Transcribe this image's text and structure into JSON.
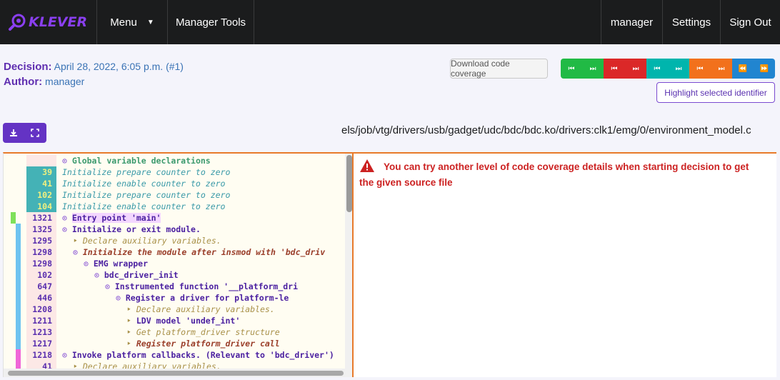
{
  "navbar": {
    "logo_text": "KLEVER",
    "menu_label": "Menu",
    "manager_tools_label": "Manager Tools",
    "user_label": "manager",
    "settings_label": "Settings",
    "signout_label": "Sign Out"
  },
  "decision": {
    "decision_label": "Decision:",
    "decision_value": "April 28, 2022, 6:05 p.m. (#1)",
    "author_label": "Author:",
    "author_value": "manager"
  },
  "toolbar": {
    "download_coverage_label": "Download code coverage",
    "highlight_label": "Highlight selected identifier",
    "nav_groups": [
      {
        "color": "#21ba45",
        "icons": [
          "skip-back-icon",
          "skip-forward-icon"
        ]
      },
      {
        "color": "#db2828",
        "icons": [
          "skip-back-icon",
          "skip-forward-icon"
        ]
      },
      {
        "color": "#00b5ad",
        "icons": [
          "skip-back-icon",
          "skip-forward-icon"
        ]
      },
      {
        "color": "#f2711c",
        "icons": [
          "skip-back-icon",
          "skip-forward-icon"
        ]
      },
      {
        "color": "#2185d0",
        "icons": [
          "rewind-icon",
          "fast-forward-icon"
        ]
      }
    ],
    "file_buttons": [
      "download-icon",
      "expand-icon"
    ]
  },
  "file_path": "els/job/vtg/drivers/usb/gadget/udc/bdc/bdc.ko/drivers:clk1/emg/0/environment_model.c",
  "code_lines": [
    {
      "num": "",
      "indent": 0,
      "icon": "⊙",
      "text": "Global variable declarations",
      "style": "green-bold",
      "num_bg": "#fce8e6",
      "bar": ""
    },
    {
      "num": "39",
      "indent": 0,
      "icon": "",
      "text": "Initialize prepare counter to zero",
      "style": "teal-italic",
      "num_bg": "#44b2b6",
      "bar": ""
    },
    {
      "num": "41",
      "indent": 0,
      "icon": "",
      "text": "Initialize enable counter to zero",
      "style": "teal-italic",
      "num_bg": "#44b2b6",
      "bar": ""
    },
    {
      "num": "102",
      "indent": 0,
      "icon": "",
      "text": "Initialize prepare counter to zero",
      "style": "teal-italic",
      "num_bg": "#44b2b6",
      "bar": ""
    },
    {
      "num": "104",
      "indent": 0,
      "icon": "",
      "text": "Initialize enable counter to zero",
      "style": "teal-italic",
      "num_bg": "#44b2b6",
      "bar": ""
    },
    {
      "num": "1321",
      "indent": 0,
      "icon": "⊙",
      "text": "Entry point 'main'",
      "style": "purple-bold-hl",
      "num_bg": "#fce8e6",
      "bar": "#7ee05a"
    },
    {
      "num": "1325",
      "indent": 0,
      "icon": "⊙",
      "text": "Initialize or exit module.",
      "style": "purple-bold",
      "num_bg": "#fce8e6",
      "bar": "#6ec3f0"
    },
    {
      "num": "1295",
      "indent": 1,
      "icon": "‣",
      "text": "Declare auxiliary variables.",
      "style": "olive-italic",
      "num_bg": "#fce8e6",
      "bar": "#6ec3f0"
    },
    {
      "num": "1298",
      "indent": 1,
      "icon": "⊙",
      "text": "Initialize the module after insmod with 'bdc_driv",
      "style": "brown-bold-italic",
      "num_bg": "#fce8e6",
      "bar": "#6ec3f0"
    },
    {
      "num": "1298",
      "indent": 2,
      "icon": "⊙",
      "text": "EMG wrapper",
      "style": "purple-bold",
      "num_bg": "#fce8e6",
      "bar": "#6ec3f0"
    },
    {
      "num": "102",
      "indent": 3,
      "icon": "⊙",
      "text": "bdc_driver_init",
      "style": "purple-bold",
      "num_bg": "#fce8e6",
      "bar": "#6ec3f0"
    },
    {
      "num": "647",
      "indent": 4,
      "icon": "⊙",
      "text": "Instrumented function '__platform_dri",
      "style": "purple-bold",
      "num_bg": "#fce8e6",
      "bar": "#6ec3f0"
    },
    {
      "num": "446",
      "indent": 5,
      "icon": "⊙",
      "text": "Register a driver for platform-le",
      "style": "purple-bold",
      "num_bg": "#fce8e6",
      "bar": "#6ec3f0"
    },
    {
      "num": "1208",
      "indent": 6,
      "icon": "‣",
      "text": "Declare auxiliary variables.",
      "style": "olive-italic",
      "num_bg": "#fce8e6",
      "bar": "#6ec3f0"
    },
    {
      "num": "1211",
      "indent": 6,
      "icon": "‣",
      "text": "LDV model 'undef_int'",
      "style": "purple-bold",
      "num_bg": "#fce8e6",
      "bar": "#6ec3f0"
    },
    {
      "num": "1213",
      "indent": 6,
      "icon": "‣",
      "text": "Get platform_driver structure",
      "style": "olive-italic",
      "num_bg": "#fce8e6",
      "bar": "#6ec3f0"
    },
    {
      "num": "1217",
      "indent": 6,
      "icon": "‣",
      "text": "Register platform_driver call",
      "style": "brown-bold-italic",
      "num_bg": "#fce8e6",
      "bar": "#6ec3f0"
    },
    {
      "num": "1218",
      "indent": 0,
      "icon": "⊙",
      "text": "Invoke platform callbacks. (Relevant to 'bdc_driver')",
      "style": "purple-bold",
      "num_bg": "#fce8e6",
      "bar": "#f066d8"
    },
    {
      "num": "41",
      "indent": 1,
      "icon": "‣",
      "text": "Declare auxiliary variables.",
      "style": "olive-italic",
      "num_bg": "#fce8e6",
      "bar": "#f066d8"
    }
  ],
  "message": {
    "icon": "warning-icon",
    "text": "You can try another level of code coverage details when starting decision to get the given source file"
  }
}
